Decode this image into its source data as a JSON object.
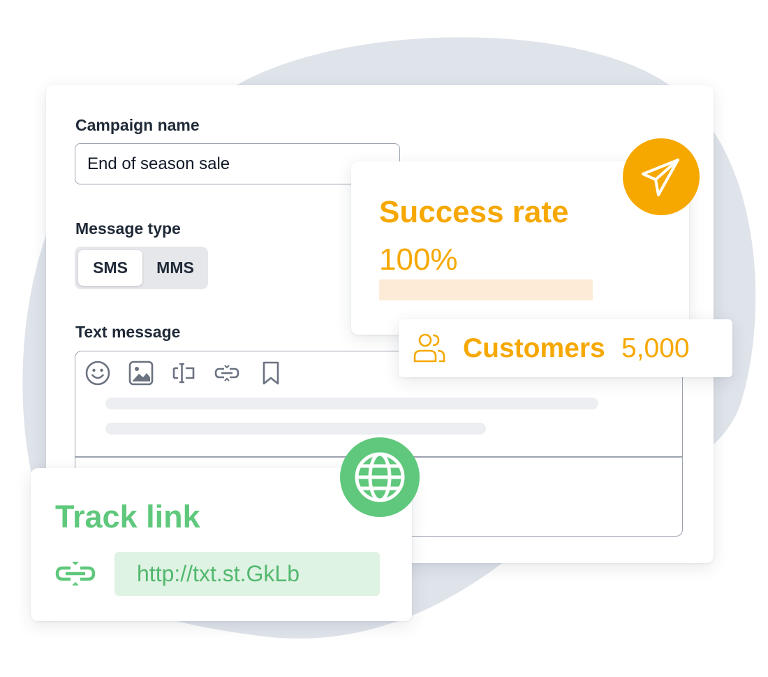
{
  "form": {
    "campaign_label": "Campaign name",
    "campaign_value": "End of season sale",
    "message_type_label": "Message type",
    "message_types": [
      "SMS",
      "MMS"
    ],
    "selected_message_type": "SMS",
    "text_message_label": "Text message",
    "toolbar_icons": [
      "emoji-icon",
      "image-icon",
      "text-field-icon",
      "link-icon",
      "bookmark-icon"
    ]
  },
  "success": {
    "title": "Success rate",
    "value": "100%",
    "progress": 1.0,
    "badge_icon": "paper-plane-icon"
  },
  "customers": {
    "icon": "users-icon",
    "label": "Customers",
    "value": "5,000"
  },
  "track": {
    "title": "Track link",
    "icon": "link-icon",
    "url": "http://txt.st.GkLb",
    "badge_icon": "globe-icon"
  },
  "colors": {
    "orange": "#f6a800",
    "green": "#5fc87c",
    "background_blob": "#dfe3ea"
  }
}
